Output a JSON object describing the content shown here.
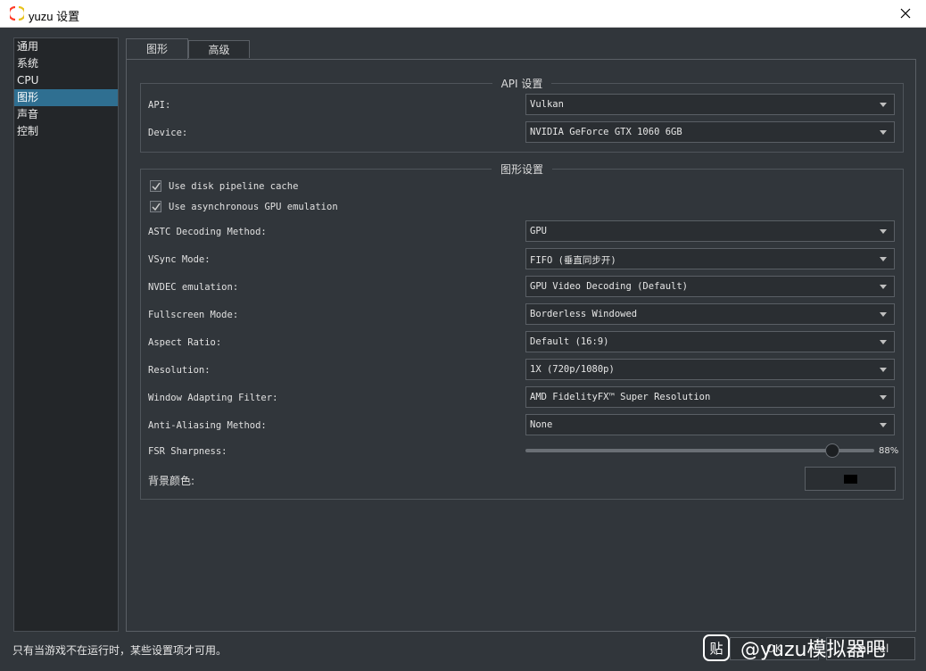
{
  "window": {
    "title": "yuzu 设置"
  },
  "sidebar": {
    "items": [
      {
        "label": "通用"
      },
      {
        "label": "系统"
      },
      {
        "label": "CPU"
      },
      {
        "label": "图形"
      },
      {
        "label": "声音"
      },
      {
        "label": "控制"
      }
    ],
    "selected": "图形"
  },
  "tabs": [
    {
      "label": "图形"
    },
    {
      "label": "高级"
    }
  ],
  "api_group": {
    "title": "API 设置",
    "api_label": "API:",
    "api_value": "Vulkan",
    "device_label": "Device:",
    "device_value": "NVIDIA GeForce GTX 1060 6GB"
  },
  "graphics_group": {
    "title": "图形设置",
    "disk_cache_label": "Use disk pipeline cache",
    "disk_cache_checked": true,
    "async_gpu_label": "Use asynchronous GPU emulation",
    "async_gpu_checked": true,
    "astc": {
      "label": "ASTC Decoding Method:",
      "value": "GPU"
    },
    "vsync": {
      "label": "VSync Mode:",
      "value": "FIFO (垂直同步开)"
    },
    "nvdec": {
      "label": "NVDEC emulation:",
      "value": "GPU Video Decoding (Default)"
    },
    "fullscreen": {
      "label": "Fullscreen Mode:",
      "value": "Borderless Windowed"
    },
    "aspect": {
      "label": "Aspect Ratio:",
      "value": "Default (16:9)"
    },
    "resolution": {
      "label": "Resolution:",
      "value": "1X (720p/1080p)"
    },
    "filter": {
      "label": "Window Adapting Filter:",
      "value": "AMD FidelityFX™ Super Resolution"
    },
    "aa": {
      "label": "Anti-Aliasing Method:",
      "value": "None"
    },
    "fsr": {
      "label": "FSR Sharpness:",
      "value_text": "88%",
      "value": 0.88
    },
    "bg_color": {
      "label": "背景颜色:",
      "color": "#000000"
    }
  },
  "footer": {
    "status": "只有当游戏不在运行时，某些设置项才可用。",
    "ok_label": "OK",
    "cancel_label": "Cancel"
  },
  "watermark": {
    "badge": "贴",
    "text": "@yuzu模拟器吧"
  },
  "colors": {
    "accent": "#2f6f91",
    "background": "#31363b"
  }
}
